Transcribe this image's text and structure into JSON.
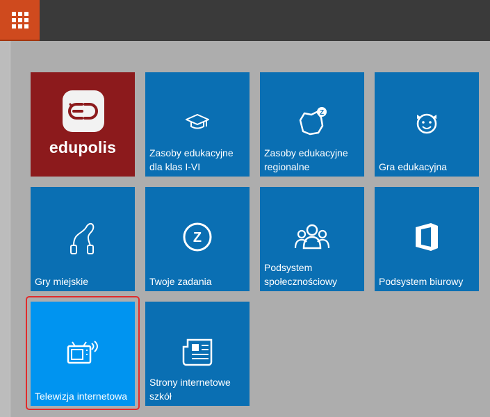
{
  "topbar": {
    "apps_icon": "app-grid-icon"
  },
  "brand_tile": {
    "name": "edupolis",
    "icon": "edupolis-logo-icon",
    "color": "#8c1a1c"
  },
  "tiles": [
    {
      "label": "Zasoby edukacyjne dla klas I-VI",
      "icon": "graduation-cap-icon"
    },
    {
      "label": "Zasoby edukacyjne regionalne",
      "icon": "region-map-icon"
    },
    {
      "label": "Gra edukacyjna",
      "icon": "child-face-icon"
    },
    {
      "label": "Gry miejskie",
      "icon": "jump-rope-icon"
    },
    {
      "label": "Twoje zadania",
      "icon": "task-z-icon"
    },
    {
      "label": "Podsystem społecznościowy",
      "icon": "community-icon"
    },
    {
      "label": "Podsystem biurowy",
      "icon": "office-icon"
    },
    {
      "label": "Telewizja internetowa",
      "icon": "tv-broadcast-icon"
    },
    {
      "label": "Strony internetowe szkół",
      "icon": "newspaper-icon"
    }
  ],
  "colors": {
    "tile": "#0a6fb3",
    "tile_selected": "#0094f0",
    "accent": "#cf4a1e",
    "selection_border": "#e12b2b"
  },
  "selected_tile": "Telewizja internetowa"
}
